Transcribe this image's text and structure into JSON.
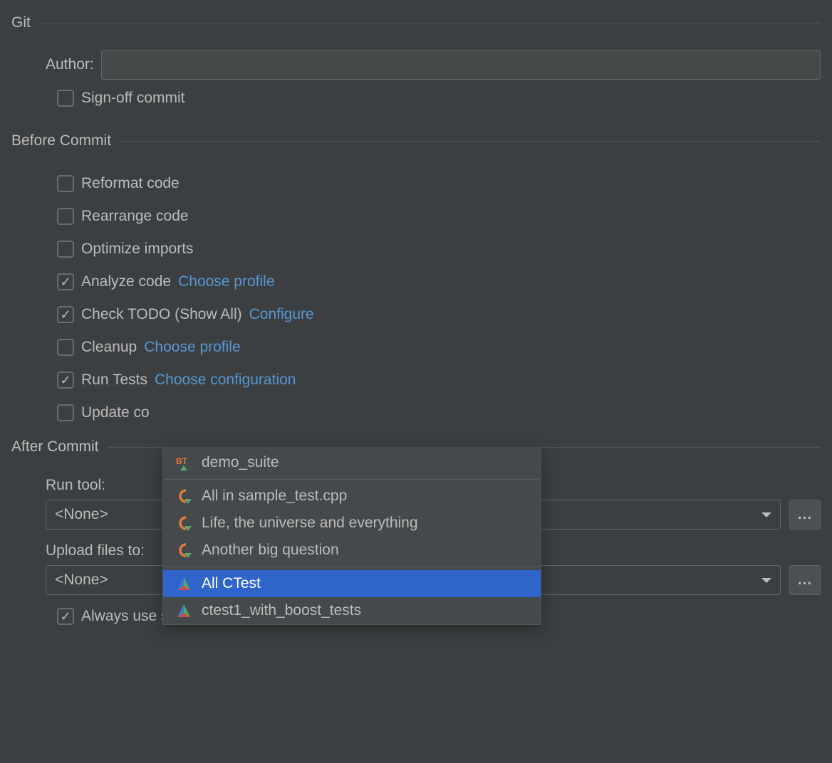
{
  "git": {
    "title": "Git",
    "author_label": "Author:",
    "author_value": "",
    "signoff_label": "Sign-off commit"
  },
  "before_commit": {
    "title": "Before Commit",
    "items": [
      {
        "label": "Reformat code",
        "checked": false,
        "link": null
      },
      {
        "label": "Rearrange code",
        "checked": false,
        "link": null
      },
      {
        "label": "Optimize imports",
        "checked": false,
        "link": null
      },
      {
        "label": "Analyze code",
        "checked": true,
        "link": "Choose profile"
      },
      {
        "label": "Check TODO (Show All)",
        "checked": true,
        "link": "Configure"
      },
      {
        "label": "Cleanup",
        "checked": false,
        "link": "Choose profile"
      },
      {
        "label": "Run Tests",
        "checked": true,
        "link": "Choose configuration"
      },
      {
        "label": "Update co",
        "checked": false,
        "link": null
      }
    ]
  },
  "after_commit": {
    "title": "After Commit",
    "run_tool_label": "Run tool:",
    "run_tool_value": "<None>",
    "upload_label": "Upload files to:",
    "upload_value": "<None>",
    "always_label": "Always use selected server or group of servers"
  },
  "popup": {
    "groups": [
      [
        {
          "label": "demo_suite",
          "icon": "bt"
        }
      ],
      [
        {
          "label": "All in sample_test.cpp",
          "icon": "catch"
        },
        {
          "label": "Life, the universe and everything",
          "icon": "catch"
        },
        {
          "label": "Another big question",
          "icon": "catch"
        }
      ],
      [
        {
          "label": "All CTest",
          "icon": "cmake",
          "selected": true
        },
        {
          "label": "ctest1_with_boost_tests",
          "icon": "cmake"
        }
      ]
    ]
  }
}
